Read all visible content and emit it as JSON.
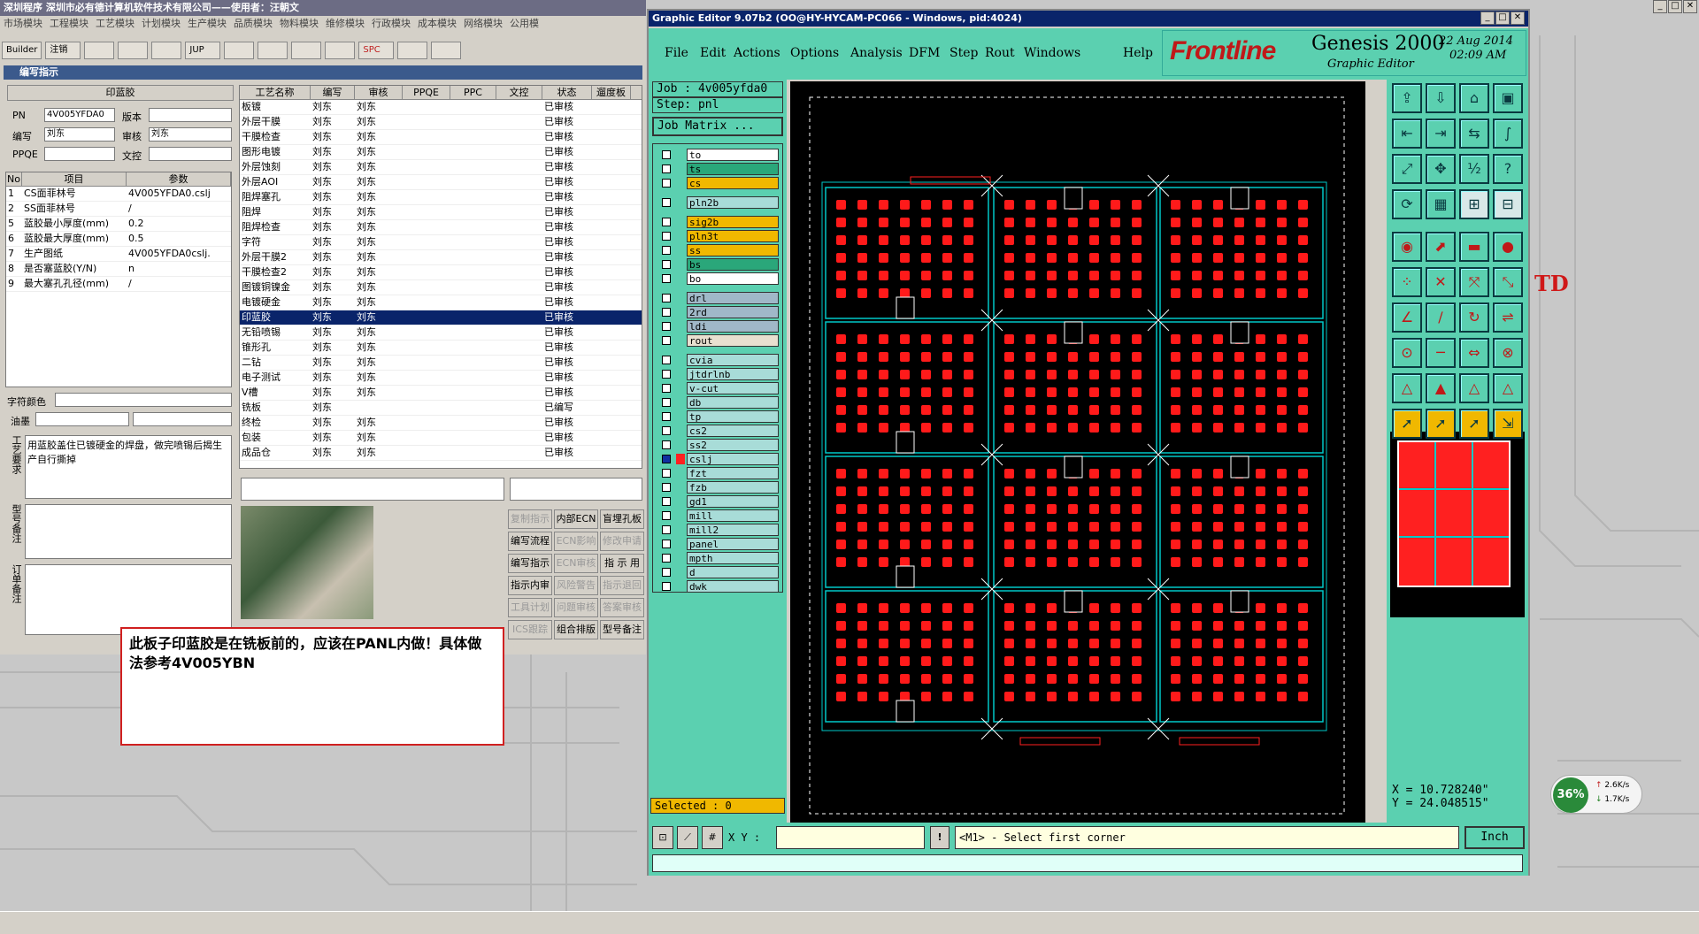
{
  "mes": {
    "title": "深圳程序    深圳市必有德计算机软件技术有限公司——使用者：汪朝文",
    "menu": [
      "市场模块",
      "工程模块",
      "工艺模块",
      "计划模块",
      "生产模块",
      "品质模块",
      "物料模块",
      "维修模块",
      "行政模块",
      "成本模块",
      "网络模块",
      "公用模"
    ],
    "toolbar": [
      "Builder",
      "注销",
      "",
      "",
      "",
      "JUP",
      "",
      "",
      "",
      "",
      "SPC",
      "",
      ""
    ],
    "subtitle": "编写指示",
    "process_name": "印蓝胶",
    "labels": {
      "pn": "PN",
      "version": "版本",
      "writer": "编写",
      "reviewer": "审核",
      "ppqe": "PPQE",
      "doc": "文控",
      "char_color": "字符颜色",
      "ink": "油墨",
      "process_req": "工艺要求",
      "model_note": "型号备注",
      "order_note": "订单备注"
    },
    "values": {
      "pn": "4V005YFDA0",
      "writer": "刘东",
      "reviewer": "刘东"
    },
    "param_headers": [
      "No",
      "项目",
      "参数"
    ],
    "params": [
      [
        "1",
        "CS面菲林号",
        "4V005YFDA0.cslj"
      ],
      [
        "2",
        "SS面菲林号",
        "/"
      ],
      [
        "5",
        "蓝胶最小厚度(mm)",
        "0.2"
      ],
      [
        "6",
        "蓝胶最大厚度(mm)",
        "0.5"
      ],
      [
        "7",
        "生产图纸",
        "4V005YFDA0cslj."
      ],
      [
        "8",
        "是否塞蓝胶(Y/N)",
        "n"
      ],
      [
        "9",
        "最大塞孔孔径(mm)",
        "/"
      ]
    ],
    "process_text": "用蓝胶盖住已镀硬金的焊盘，做完喷锡后揭生产自行撕掉",
    "proc_headers": [
      "工艺名称",
      "编写",
      "审核",
      "PPQE",
      "PPC",
      "文控",
      "状态",
      "遛度板"
    ],
    "procs": [
      [
        "板镀",
        "刘东",
        "刘东",
        "已审核"
      ],
      [
        "外层干膜",
        "刘东",
        "刘东",
        "已审核"
      ],
      [
        "干膜检查",
        "刘东",
        "刘东",
        "已审核"
      ],
      [
        "图形电镀",
        "刘东",
        "刘东",
        "已审核"
      ],
      [
        "外层蚀刻",
        "刘东",
        "刘东",
        "已审核"
      ],
      [
        "外层AOI",
        "刘东",
        "刘东",
        "已审核"
      ],
      [
        "阻焊塞孔",
        "刘东",
        "刘东",
        "已审核"
      ],
      [
        "阻焊",
        "刘东",
        "刘东",
        "已审核"
      ],
      [
        "阻焊检查",
        "刘东",
        "刘东",
        "已审核"
      ],
      [
        "字符",
        "刘东",
        "刘东",
        "已审核"
      ],
      [
        "外层干膜2",
        "刘东",
        "刘东",
        "已审核"
      ],
      [
        "干膜检查2",
        "刘东",
        "刘东",
        "已审核"
      ],
      [
        "图镀铜镍金",
        "刘东",
        "刘东",
        "已审核"
      ],
      [
        "电镀硬金",
        "刘东",
        "刘东",
        "已审核"
      ],
      [
        "印蓝胶",
        "刘东",
        "刘东",
        "已审核"
      ],
      [
        "无铅喷锡",
        "刘东",
        "刘东",
        "已审核"
      ],
      [
        "锥形孔",
        "刘东",
        "刘东",
        "已审核"
      ],
      [
        "二钻",
        "刘东",
        "刘东",
        "已审核"
      ],
      [
        "电子测试",
        "刘东",
        "刘东",
        "已审核"
      ],
      [
        "V槽",
        "刘东",
        "刘东",
        "已审核"
      ],
      [
        "铣板",
        "刘东",
        "",
        "已编写"
      ],
      [
        "终检",
        "刘东",
        "刘东",
        "已审核"
      ],
      [
        "包装",
        "刘东",
        "刘东",
        "已审核"
      ],
      [
        "成品仓",
        "刘东",
        "刘东",
        "已审核"
      ]
    ],
    "buttons": [
      [
        "复制指示",
        "内部ECN",
        "盲埋孔板"
      ],
      [
        "编写流程",
        "ECN影响",
        "修改申请"
      ],
      [
        "编写指示",
        "ECN审核",
        "指 示 用"
      ],
      [
        "指示内审",
        "风险警告",
        "指示退回"
      ],
      [
        "工具计划",
        "问题审核",
        "答案审核"
      ],
      [
        "ICS跟踪",
        "组合排版",
        "型号备注"
      ]
    ]
  },
  "note": "此板子印蓝胶是在铣板前的，应该在PANL内做！具体做法参考4V005YBN",
  "genesis": {
    "title": "Graphic Editor 9.07b2 (OO@HY-HYCAM-PC066 - Windows, pid:4024)",
    "menu": [
      "File",
      "Edit",
      "Actions",
      "Options",
      "Analysis",
      "DFM",
      "Step",
      "Rout",
      "Windows",
      "Help"
    ],
    "brand": "Frontline",
    "product": "Genesis 2000",
    "subproduct": "Graphic Editor",
    "date": "22 Aug 2014",
    "time": "02:09 AM",
    "job": "Job : 4v005yfda0",
    "step": "Step: pnl",
    "job_matrix": "Job Matrix ...",
    "layers": [
      {
        "name": "to",
        "color": "#ffffff"
      },
      {
        "name": "ts",
        "color": "#2aa77a"
      },
      {
        "name": "cs",
        "color": "#f0b800"
      },
      {
        "name": "pln2b",
        "color": "#a8dcd8"
      },
      {
        "name": "sig2b",
        "color": "#f0b800"
      },
      {
        "name": "pln3t",
        "color": "#f0b800"
      },
      {
        "name": "ss",
        "color": "#f0b800"
      },
      {
        "name": "bs",
        "color": "#2aa77a"
      },
      {
        "name": "bo",
        "color": "#ffffff"
      },
      {
        "name": "drl",
        "color": "#a0b8c8"
      },
      {
        "name": "2rd",
        "color": "#a0b8c8"
      },
      {
        "name": "ldi",
        "color": "#a0b8c8"
      },
      {
        "name": "rout",
        "color": "#e8e0d0"
      },
      {
        "name": "cvia",
        "color": "#a8dcd8"
      },
      {
        "name": "jtdrlnb",
        "color": "#a8dcd8"
      },
      {
        "name": "v-cut",
        "color": "#a8dcd8"
      },
      {
        "name": "db",
        "color": "#a8dcd8"
      },
      {
        "name": "tp",
        "color": "#a8dcd8"
      },
      {
        "name": "cs2",
        "color": "#a8dcd8"
      },
      {
        "name": "ss2",
        "color": "#a8dcd8"
      },
      {
        "name": "cslj",
        "color": "#a8dcd8"
      },
      {
        "name": "fzt",
        "color": "#a8dcd8"
      },
      {
        "name": "fzb",
        "color": "#a8dcd8"
      },
      {
        "name": "gd1",
        "color": "#a8dcd8"
      },
      {
        "name": "mill",
        "color": "#a8dcd8"
      },
      {
        "name": "mill2",
        "color": "#a8dcd8"
      },
      {
        "name": "panel",
        "color": "#a8dcd8"
      },
      {
        "name": "mpth",
        "color": "#a8dcd8"
      },
      {
        "name": "d",
        "color": "#a8dcd8"
      },
      {
        "name": "dwk",
        "color": "#a8dcd8"
      }
    ],
    "selected": "Selected : 0",
    "xy_label": "X Y :",
    "prompt": "<M1> - Select first corner",
    "unit": "Inch",
    "coord_x": "X = 10.728240\"",
    "coord_y": "Y = 24.048515\"",
    "side_text": "TD"
  },
  "net": {
    "pct": "36%",
    "up": "2.6K/s",
    "down": "1.7K/s"
  }
}
